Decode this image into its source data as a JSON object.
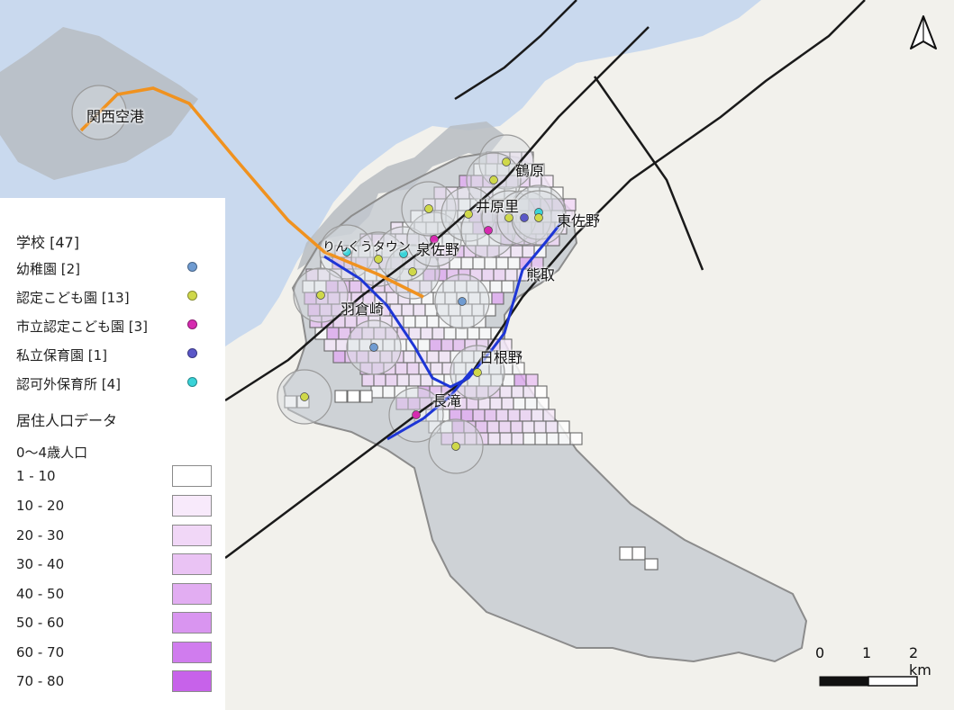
{
  "legend": {
    "schools_header": "学校 [47]",
    "school_types": [
      {
        "label": "幼稚園 [2]",
        "color": "#6f9bd1"
      },
      {
        "label": "認定こども園 [13]",
        "color": "#cfd84a"
      },
      {
        "label": "市立認定こども園 [3]",
        "color": "#d62ab0"
      },
      {
        "label": "私立保育園 [1]",
        "color": "#5a57c8"
      },
      {
        "label": "認可外保育所 [4]",
        "color": "#39d3d8"
      }
    ],
    "population_header": "居住人口データ",
    "population_subheader": "0～4歳人口",
    "population_classes": [
      {
        "label": "1 - 10",
        "color": "#ffffff"
      },
      {
        "label": "10 - 20",
        "color": "#f8eafb"
      },
      {
        "label": "20 - 30",
        "color": "#f1d7f7"
      },
      {
        "label": "30 - 40",
        "color": "#eac3f4"
      },
      {
        "label": "40 - 50",
        "color": "#e2adf2"
      },
      {
        "label": "50 - 60",
        "color": "#d995f0"
      },
      {
        "label": "60 - 70",
        "color": "#d07cee"
      },
      {
        "label": "70 - 80",
        "color": "#c762ea"
      }
    ]
  },
  "place_labels": {
    "kansai_airport": "関西空港",
    "rinku_town": "りんくうタウン",
    "izumisano": "泉佐野",
    "tsuruhara": "鶴原",
    "iharanosato": "井原里",
    "higashi_sano": "東佐野",
    "kumatori": "熊取",
    "hagurasaki": "羽倉崎",
    "hineno": "日根野",
    "nagataki": "長滝"
  },
  "scale_bar": {
    "ticks": [
      "0",
      "1",
      "2 km"
    ]
  },
  "north_arrow": "N",
  "colors": {
    "sea": "#c9d9ee",
    "land": "#f2f1ec",
    "city_boundary_fill": "#b9bfc7",
    "railway_jr": "#1a1a1a",
    "railway_nankai": "#1d35d6",
    "railway_airport": "#f0921f",
    "grid_outline": "#6a6a6a"
  }
}
